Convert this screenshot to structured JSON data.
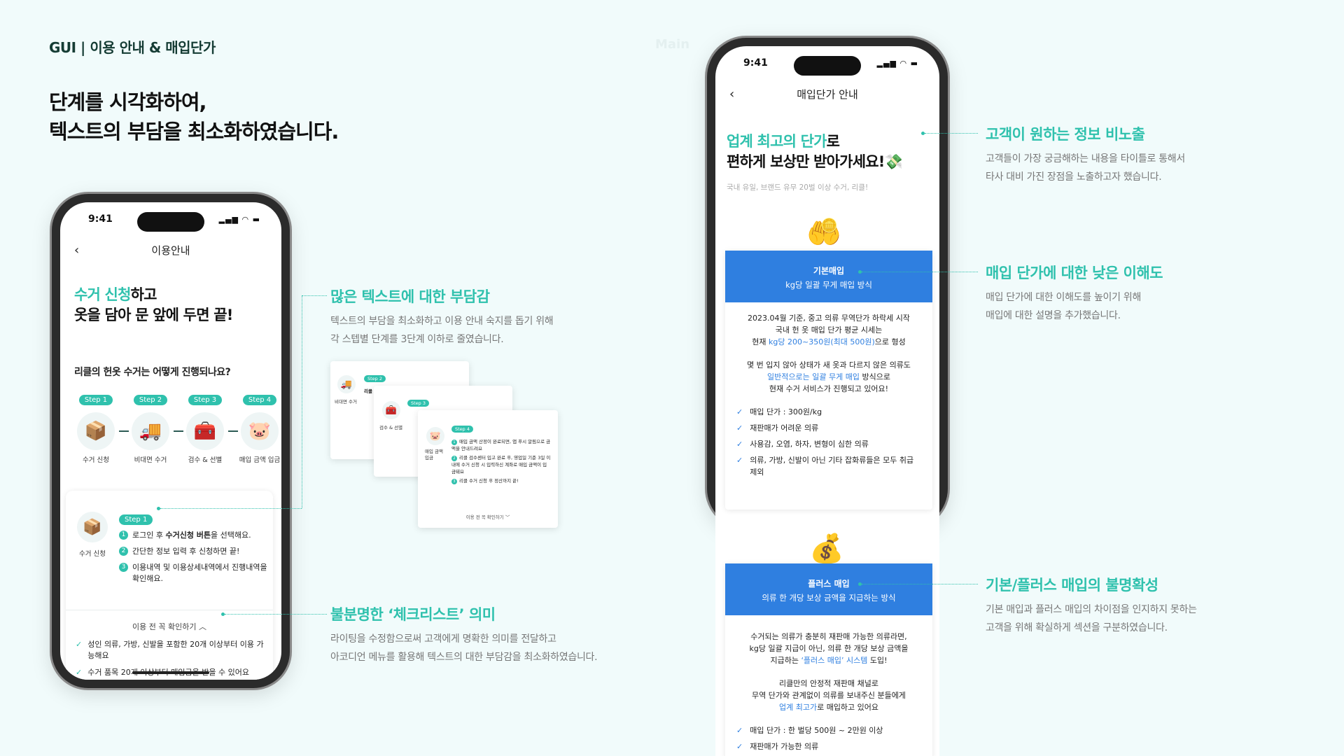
{
  "header": {
    "label": "GUI | 이용 안내 & 매입단가",
    "faint_label": "Main"
  },
  "headline": {
    "line1": "단계를 시각화하여,",
    "line2": "텍스트의 부담을 최소화하였습니다."
  },
  "status_bar": {
    "time": "9:41",
    "icons": "▂▄▆ ◠ ▬"
  },
  "icons": {
    "back": "‹",
    "box": "📦",
    "truck": "🚚",
    "inspect": "🧰",
    "piggy": "🐷",
    "coin": "🪙",
    "hand": "🤲",
    "money_bag": "💰",
    "money_wings": "💸",
    "check": "✓",
    "chevron_up": "︿",
    "chevron_down": "﹀"
  },
  "phone1": {
    "nav_title": "이용안내",
    "title_accent": "수거 신청",
    "title_rest": "하고",
    "title_line2": "옷을 담아 문 앞에 두면 끝!",
    "question": "리클의 헌옷 수거는 어떻게 진행되나요?",
    "steps": [
      {
        "badge": "Step 1",
        "label": "수거 신청"
      },
      {
        "badge": "Step 2",
        "label": "비대면 수거"
      },
      {
        "badge": "Step 3",
        "label": "검수 & 선별"
      },
      {
        "badge": "Step 4",
        "label": "매입 금액 입금"
      }
    ],
    "card": {
      "badge": "Step 1",
      "icon_label": "수거 신청",
      "item1_pre": "로그인 후 ",
      "item1_bold": "수거신청 버튼",
      "item1_post": "을 선택해요.",
      "item2": "간단한 정보 입력 후 신청하면 끝!",
      "item3": "이용내역 및 이용상세내역에서 진행내역을 확인해요.",
      "accordion": "이용 전 꼭 확인하기",
      "checks": [
        "성인 의류, 가방, 신발을 포함한 20개 이상부터 이용 가능해요",
        "수거 품목 20개 이상부터 매입금을 받을 수 있어요"
      ]
    }
  },
  "mini_cards": {
    "card1": {
      "badge": "Step 2",
      "icon_label": "비대면 수거",
      "text": "리클"
    },
    "card2": {
      "badge": "Step 3",
      "icon_label": "검수 & 선별"
    },
    "card3": {
      "badge": "Step 4",
      "icon_label": "매입 금액 입금",
      "item1": "매입 금액 산정이 완료되면, 앱 푸시 알림으로 금액을 안내드려요",
      "item2": "리클 검수센터 입고 완료 후, 영업일 기준 3일 이내에 수거 신청 시 입력하신 계좌로 매입 금액이 입금돼요",
      "item3": "리클 수거 신청 후 정산까지 끝!",
      "footer": "이용 전 꼭 확인하기"
    }
  },
  "annotations": {
    "a1": {
      "title": "많은 텍스트에 대한 부담감",
      "desc1": "텍스트의 부담을 최소화하고 이용 안내 숙지를 돕기 위해",
      "desc2": "각 스텝별 단계를 3단계 이하로 줄였습니다."
    },
    "a2": {
      "title": "불분명한 ‘체크리스트’ 의미",
      "desc1": "라이팅을 수정함으로써 고객에게 명확한 의미를 전달하고",
      "desc2": "아코디언 메뉴를 활용해 텍스트의 대한 부담감을 최소화하였습니다."
    },
    "a3": {
      "title": "고객이 원하는 정보 비노출",
      "desc1": "고객들이 가장 궁금해하는 내용을 타이틀로 통해서",
      "desc2": "타사 대비 가진 장점을 노출하고자 했습니다."
    },
    "a4": {
      "title": "매입 단가에 대한 낮은 이해도",
      "desc1": "매입 단가에 대한 이해도를 높이기 위해",
      "desc2": "매입에 대한 설명을 추가했습니다."
    },
    "a5": {
      "title": "기본/플러스 매입의 불명확성",
      "desc1": "기본 매입과 플러스 매입의 차이점을 인지하지 못하는",
      "desc2": "고객을 위해 확실하게 섹션을 구분하였습니다."
    }
  },
  "phone2": {
    "nav_title": "매입단가 안내",
    "title_accent": "업계 최고의 단가",
    "title_rest": "로",
    "title_line2": "편하게 보상만 받아가세요!",
    "subtitle": "국내 유일, 브랜드 유무 20벌 이상 수거, 리클!",
    "basic": {
      "title": "기본매입",
      "sub": "kg당 일괄 무게 매입 방식",
      "p1_l1": "2023.04월 기준, 중고 의류 무역단가 하락세 시작",
      "p1_l2": "국내 헌 옷 매입 단가 평균 시세는",
      "p1_l3_pre": "현재 ",
      "p1_l3_accent": "kg당 200~350원(최대 500원)",
      "p1_l3_post": "으로 형성",
      "p2_l1": "몇 번 입지 않아 상태가 새 옷과 다르지 않은 의류도",
      "p2_l2_accent": "일반적으로는 일괄 무게 매입",
      "p2_l2_post": " 방식으로",
      "p2_l3": "현재 수거 서비스가 진행되고 있어요!",
      "bullets": [
        "매입 단가 : 300원/kg",
        "재판매가 어려운 의류",
        "사용감, 오염, 하자, 변형이 심한 의류",
        "의류, 가방, 신발이 아닌 기타 잡화류들은 모두 취급 제외"
      ]
    },
    "plus": {
      "title": "플러스 매입",
      "sub": "의류 한 개당 보상 금액을 지급하는 방식",
      "p1_l1": "수거되는 의류가 충분히 재판매 가능한 의류라면,",
      "p1_l2": "kg당 일괄 지급이 아닌, 의류 한 개당 보상 금액을",
      "p1_l3_pre": "지급하는 ",
      "p1_l3_accent": "‘플러스 매입’ 시스템",
      "p1_l3_post": " 도입!",
      "p2_l1": "리클만의 안정적 재판매 채널로",
      "p2_l2": "무역 단가와 관계없이 의류를 보내주신 분들에게",
      "p2_l3_accent": "업계 최고가",
      "p2_l3_post": "로 매입하고 있어요",
      "bullets": [
        "매입 단가 : 한 벌당 500원 ~ 2만원 이상",
        "재판매가 가능한 의류"
      ]
    }
  },
  "colors": {
    "accent_teal": "#2fc1ad",
    "accent_blue": "#2f7fe0",
    "background": "#f1fbfb"
  }
}
